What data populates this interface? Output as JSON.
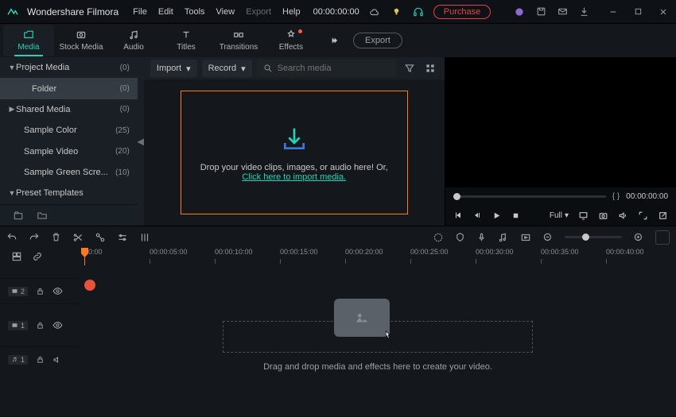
{
  "title": "Wondershare Filmora",
  "menu": {
    "file": "File",
    "edit": "Edit",
    "tools": "Tools",
    "view": "View",
    "export": "Export",
    "help": "Help"
  },
  "titlebar_timecode": "00:00:00:00",
  "purchase": "Purchase",
  "tabs": {
    "media": "Media",
    "stock": "Stock Media",
    "audio": "Audio",
    "titles": "Titles",
    "transitions": "Transitions",
    "effects": "Effects"
  },
  "exportbtn": "Export",
  "sidebar": {
    "project_media": "Project Media",
    "project_media_count": "(0)",
    "folder": "Folder",
    "folder_count": "(0)",
    "shared_media": "Shared Media",
    "shared_media_count": "(0)",
    "sample_color": "Sample Color",
    "sample_color_count": "(25)",
    "sample_video": "Sample Video",
    "sample_video_count": "(20)",
    "sample_green": "Sample Green Scre...",
    "sample_green_count": "(10)",
    "preset_templates": "Preset Templates"
  },
  "mediapanel": {
    "import": "Import",
    "record": "Record",
    "search_placeholder": "Search media",
    "drop_line": "Drop your video clips, images, or audio here! Or,",
    "drop_link": "Click here to import media."
  },
  "preview": {
    "braces": "{      }",
    "timecode": "00:00:00:00",
    "full": "Full"
  },
  "ruler": {
    "ticks": [
      "00:00",
      "00:00:05:00",
      "00:00:10:00",
      "00:00:15:00",
      "00:00:20:00",
      "00:00:25:00",
      "00:00:30:00",
      "00:00:35:00",
      "00:00:40:00"
    ]
  },
  "tracks": {
    "v2": "2",
    "v1": "1",
    "a1": "1"
  },
  "timeline_hint": "Drag and drop media and effects here to create your video."
}
